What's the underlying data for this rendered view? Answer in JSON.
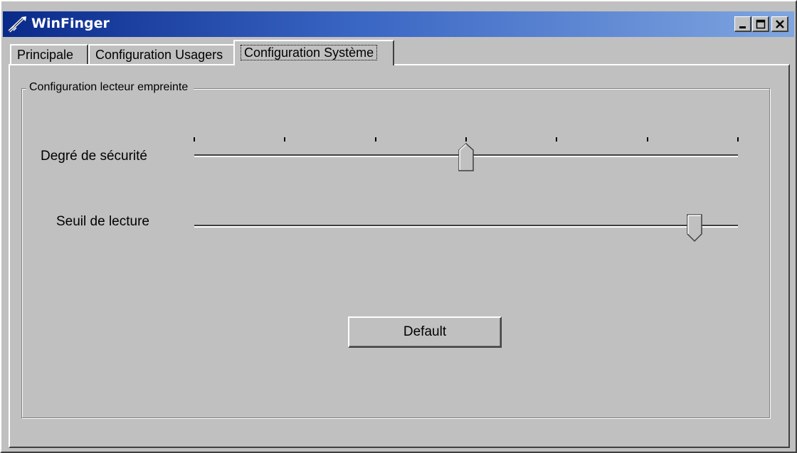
{
  "window": {
    "title": "WinFinger",
    "controls": {
      "minimize": "minimize-icon",
      "maximize": "maximize-icon",
      "close": "close-icon"
    }
  },
  "tabs": [
    {
      "label": "Principale",
      "active": false
    },
    {
      "label": "Configuration Usagers",
      "active": false
    },
    {
      "label": "Configuration Système",
      "active": true
    }
  ],
  "group": {
    "title": "Configuration lecteur empreinte"
  },
  "sliders": [
    {
      "label": "Degré de sécurité",
      "ticks": 7,
      "position": 0.5
    },
    {
      "label": "Seuil de lecture",
      "ticks": 0,
      "position": 0.92
    }
  ],
  "buttons": {
    "default_label": "Default"
  },
  "colors": {
    "window_bg": "#c0c0c0",
    "titlebar_start": "#0a2a8a",
    "titlebar_end": "#7fa6e0"
  }
}
